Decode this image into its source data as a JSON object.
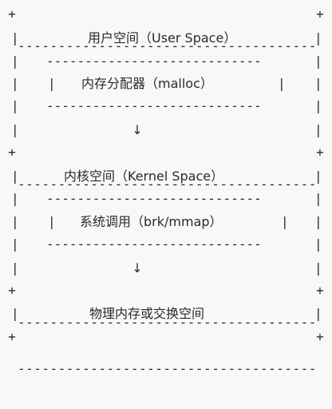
{
  "diagram": {
    "border_line": "+-----------------------------------------+",
    "inner_separator": "----------------------------",
    "pipe": "|",
    "arrow": "↓",
    "user_space": {
      "title": "用户空间（User Space）",
      "component": "内存分配器（malloc）"
    },
    "kernel_space": {
      "title": "内核空间（Kernel Space）",
      "component": "系统调用（brk/mmap）"
    },
    "physical": {
      "title": "物理内存或交换空间"
    }
  }
}
